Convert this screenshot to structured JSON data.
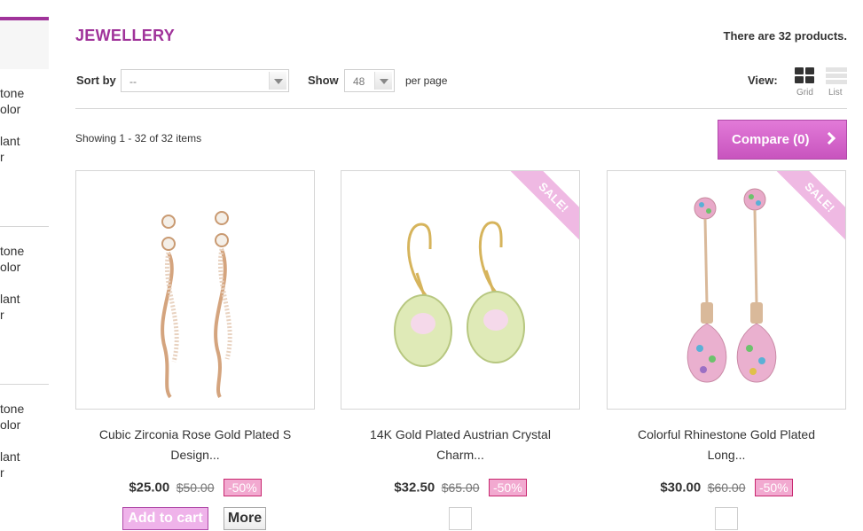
{
  "sidebar": {
    "groups": [
      {
        "line1": "tone",
        "line2": "olor",
        "line3": "lant",
        "line4": "r"
      },
      {
        "line1": "tone",
        "line2": "olor",
        "line3": "lant",
        "line4": "r"
      },
      {
        "line1": "tone",
        "line2": "olor",
        "line3": "lant",
        "line4": "r"
      }
    ]
  },
  "header": {
    "title": "JEWELLERY",
    "count": "There are 32 products."
  },
  "toolbar": {
    "sort_label": "Sort by",
    "sort_value": "--",
    "show_label": "Show",
    "show_value": "48",
    "per_page": "per page",
    "view_label": "View:",
    "grid_caption": "Grid",
    "list_caption": "List"
  },
  "listing": {
    "showing": "Showing 1 - 32 of 32 items",
    "compare_label": "Compare (0)"
  },
  "products": [
    {
      "name_line1": "Cubic Zirconia Rose Gold Plated S",
      "name_line2": "Design...",
      "price": "$25.00",
      "old_price": "$50.00",
      "discount": "-50%",
      "sale": "",
      "add_to_cart": "Add to cart",
      "more": "More"
    },
    {
      "name_line1": "14K Gold Plated Austrian Crystal",
      "name_line2": "Charm...",
      "price": "$32.50",
      "old_price": "$65.00",
      "discount": "-50%",
      "sale": "SALE!"
    },
    {
      "name_line1": "Colorful Rhinestone Gold Plated",
      "name_line2": "Long...",
      "price": "$30.00",
      "old_price": "$60.00",
      "discount": "-50%",
      "sale": "SALE!"
    }
  ],
  "colors": {
    "accent": "#a0339a",
    "button_pink": "#c854be",
    "discount_bg": "#f2a9d0",
    "ribbon": "#efb9e3"
  }
}
